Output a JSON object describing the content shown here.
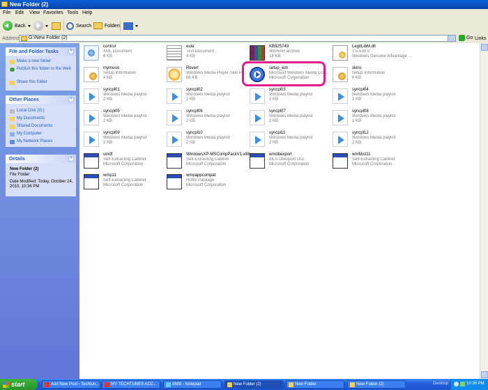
{
  "window": {
    "title": "New Folder (2)"
  },
  "menu": [
    "File",
    "Edit",
    "View",
    "Favorites",
    "Tools",
    "Help"
  ],
  "toolbar": {
    "back": "Back",
    "search": "Search",
    "folders": "Folders"
  },
  "address": {
    "label": "Address",
    "path": "G:\\New Folder (2)",
    "go": "Go",
    "links": "Links"
  },
  "left_pane": {
    "tasks": {
      "title": "File and Folder Tasks",
      "items": [
        "Make a new folder",
        "Publish this folder to the Web",
        "Share this folder"
      ]
    },
    "places": {
      "title": "Other Places",
      "items": [
        "Local Disk (G:)",
        "My Documents",
        "Shared Documents",
        "My Computer",
        "My Network Places"
      ]
    },
    "details": {
      "title": "Details",
      "name": "New Folder (2)",
      "type": "File Folder",
      "modified": "Date Modified: Today, October 24, 2010, 10:36 PM"
    }
  },
  "files": [
    {
      "name": "control",
      "type": "XML Document",
      "size": "6 KB",
      "icon": "xml-icon"
    },
    {
      "name": "eula",
      "type": "Text Document",
      "size": "4 KB",
      "icon": "text-document-icon"
    },
    {
      "name": "KB925749",
      "type": "WinRAR archive",
      "size": "18 KB",
      "icon": "winrar-icon"
    },
    {
      "name": "LegitLibM.dll",
      "type": "1.5.530.0",
      "size": "Windows Genuine Advantage ...",
      "icon": "dll-icon"
    },
    {
      "name": "mymusic",
      "type": "Setup Information",
      "size": "4 KB",
      "icon": "setup-info-icon"
    },
    {
      "name": "Revert",
      "type": "Windows Media Player Skin Pa...",
      "size": "66 KB",
      "icon": "wmp-skin-icon"
    },
    {
      "name": "setup_wm",
      "type": "Microsoft Windows Media Con...",
      "size": "Microsoft Corporation",
      "icon": "windows-media-player-icon"
    },
    {
      "name": "skins",
      "type": "Setup Information",
      "size": "6 KB",
      "icon": "setup-info-icon"
    },
    {
      "name": "syncpl01",
      "type": "Windows Media playlist",
      "size": "2 KB",
      "icon": "playlist-icon"
    },
    {
      "name": "syncpl02",
      "type": "Windows Media playlist",
      "size": "2 KB",
      "icon": "playlist-icon"
    },
    {
      "name": "syncpl03",
      "type": "Windows Media playlist",
      "size": "2 KB",
      "icon": "playlist-icon"
    },
    {
      "name": "syncpl04",
      "type": "Windows Media playlist",
      "size": "2 KB",
      "icon": "playlist-icon"
    },
    {
      "name": "syncpl05",
      "type": "Windows Media playlist",
      "size": "2 KB",
      "icon": "playlist-icon"
    },
    {
      "name": "syncpl06",
      "type": "Windows Media playlist",
      "size": "2 KB",
      "icon": "playlist-icon"
    },
    {
      "name": "syncpl07",
      "type": "Windows Media playlist",
      "size": "2 KB",
      "icon": "playlist-icon"
    },
    {
      "name": "syncpl08",
      "type": "Windows Media playlist",
      "size": "1 KB",
      "icon": "playlist-icon"
    },
    {
      "name": "syncpl09",
      "type": "Windows Media playlist",
      "size": "2 KB",
      "icon": "playlist-icon"
    },
    {
      "name": "syncpl10",
      "type": "Windows Media playlist",
      "size": "2 KB",
      "icon": "playlist-icon"
    },
    {
      "name": "syncpl11",
      "type": "Windows Media playlist",
      "size": "2 KB",
      "icon": "playlist-icon"
    },
    {
      "name": "syncpl12",
      "type": "Windows Media playlist",
      "size": "2 KB",
      "icon": "playlist-icon"
    },
    {
      "name": "umdf",
      "type": "Self-Extracting Cabinet",
      "size": "Microsoft Corporation",
      "icon": "cabinet-icon"
    },
    {
      "name": "WindowsXP-MSCompPackV1-x86",
      "type": "Self-Extracting Cabinet",
      "size": "Microsoft Corporation",
      "icon": "cabinet-icon"
    },
    {
      "name": "wmdbexport",
      "type": "MLS Dbexport DLL",
      "size": "Microsoft Corporation",
      "icon": "cabinet-icon"
    },
    {
      "name": "wmfdist11",
      "type": "Self-Extracting Cabinet",
      "size": "Microsoft Corporation",
      "icon": "cabinet-icon"
    },
    {
      "name": "wmp11",
      "type": "Self-Extracting Cabinet",
      "size": "Microsoft Corporation",
      "icon": "cabinet-icon"
    },
    {
      "name": "wmpappcompat",
      "type": "Hotfix Package",
      "size": "Microsoft Corporation",
      "icon": "hotfix-icon"
    }
  ],
  "taskbar": {
    "start": "start",
    "tasks": [
      "Add New Post ‹ Techtun...",
      "MY TECHTUNES ACC...",
      "dfdfd - Notepad",
      "New Folder (2)",
      "New Folder",
      "New Folder (2)"
    ],
    "desktop": "Desktop",
    "clock": "10:36 PM"
  },
  "colors": {
    "highlight": "#e31a8c",
    "titlebar": "#0a5fd6",
    "taskbar": "#245edb",
    "link": "#215dc6"
  }
}
